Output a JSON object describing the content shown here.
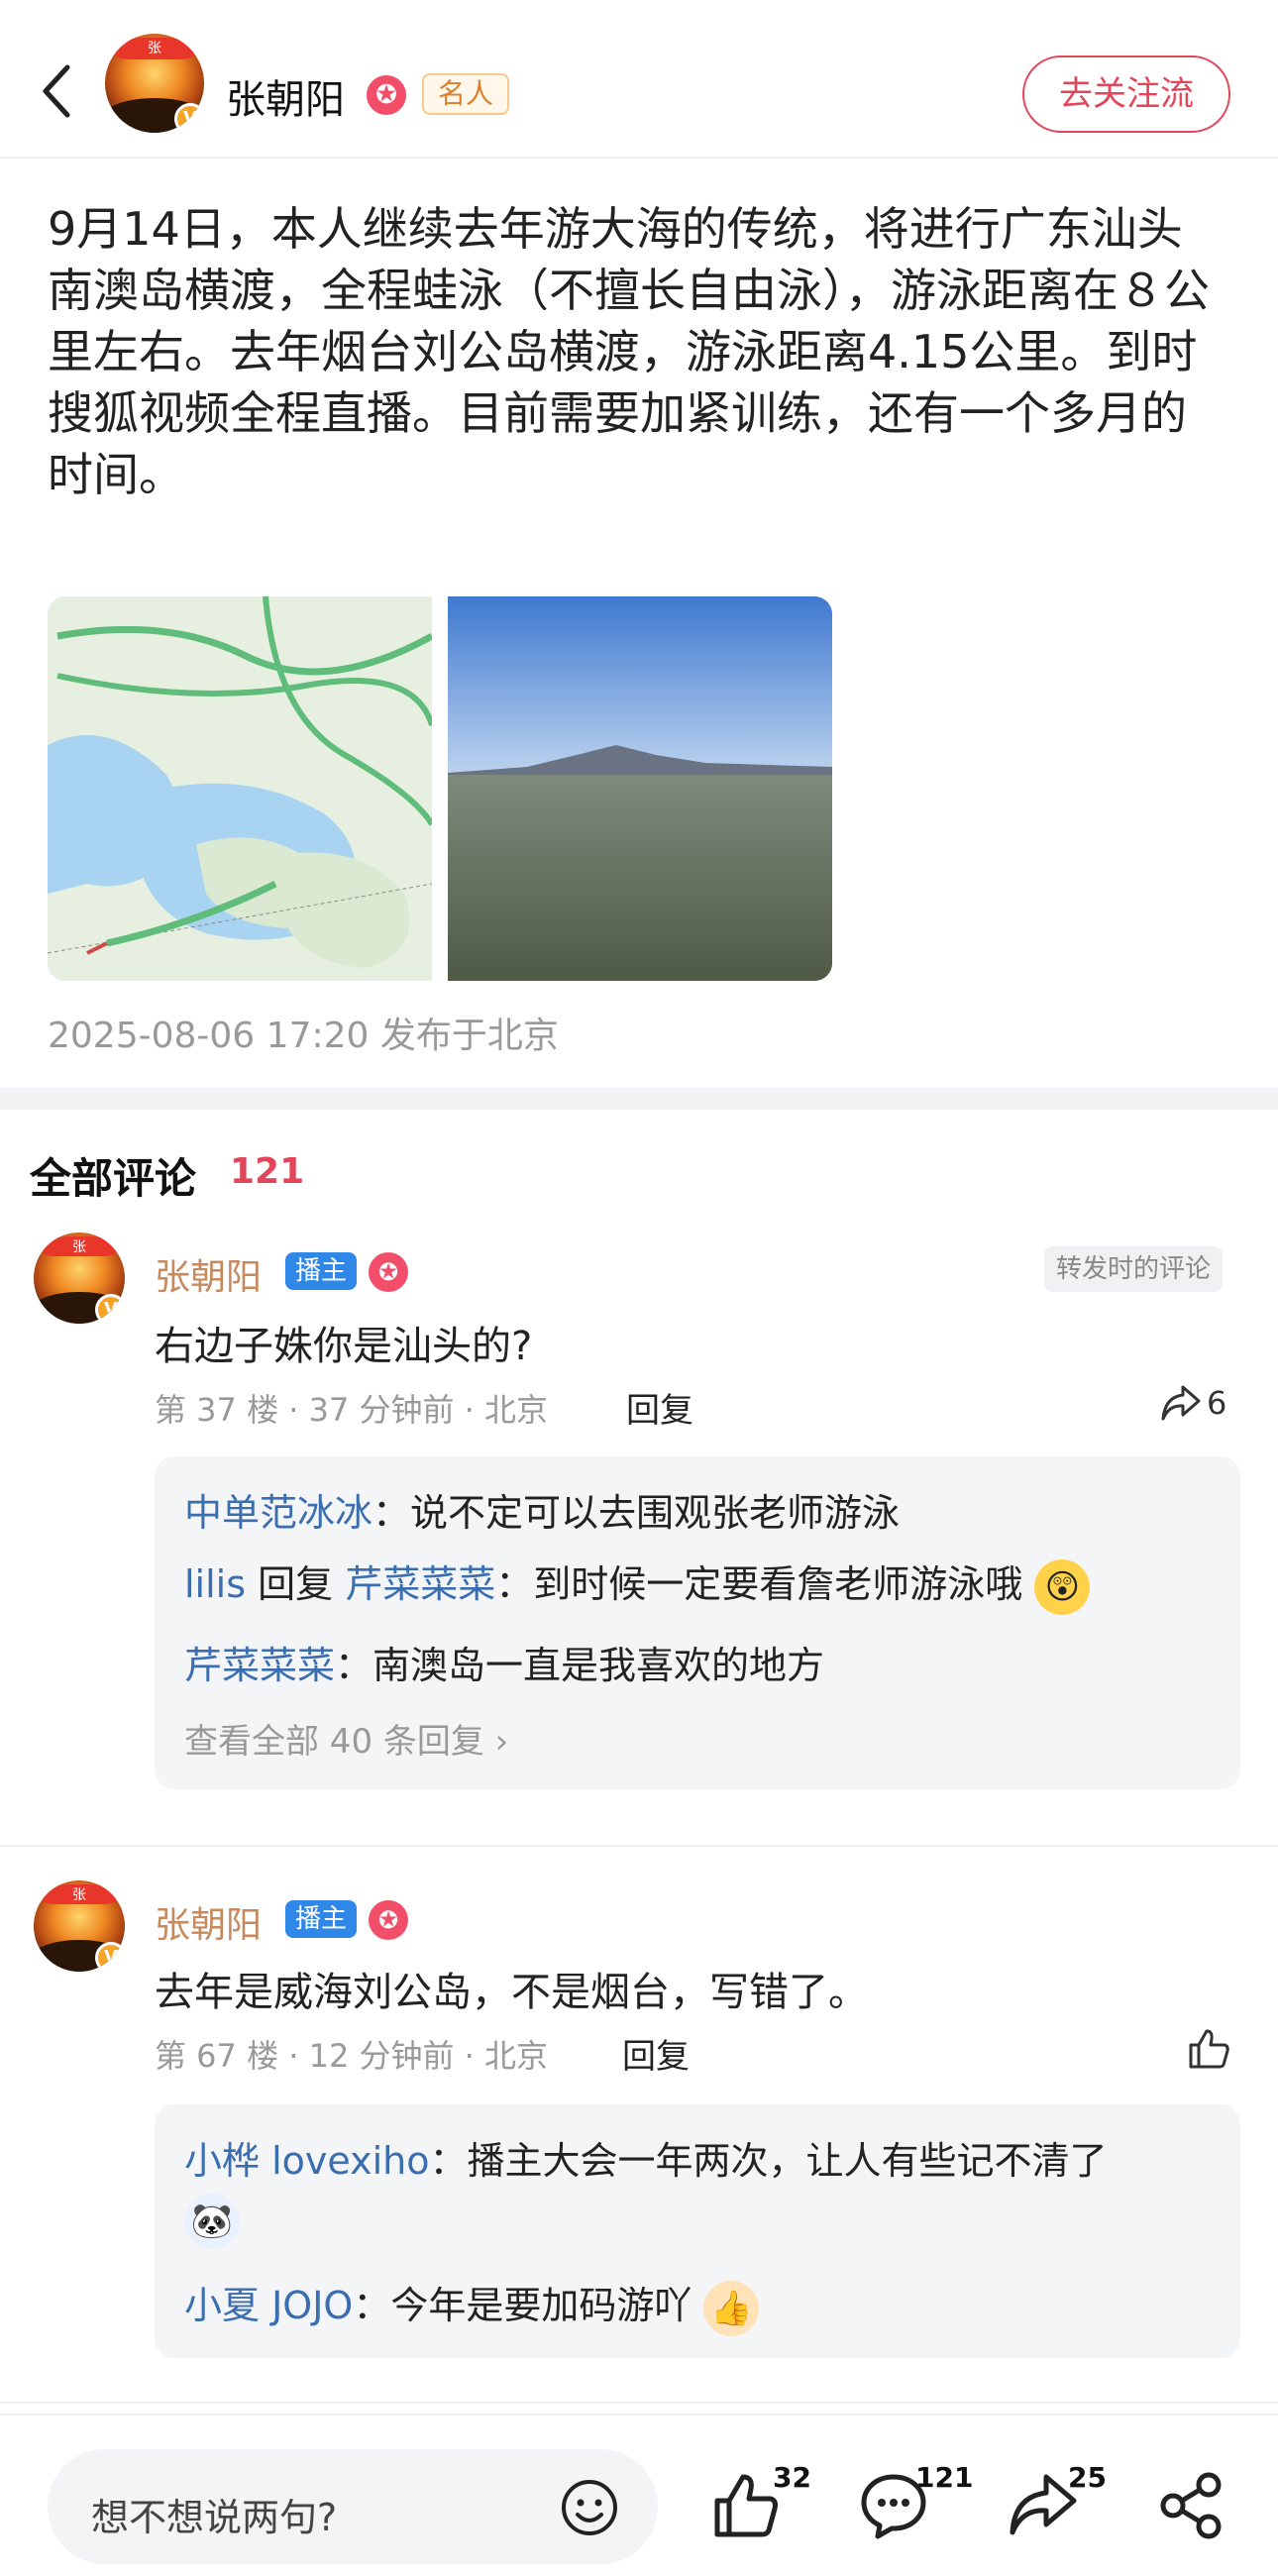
{
  "header": {
    "author_name": "张朝阳",
    "celebrity_tag": "名人",
    "unfollow_label": "去关注流",
    "avatar_crest": "张"
  },
  "post": {
    "text": "9月14日，本人继续去年游大海的传统，将进行广东汕头南澳岛横渡，全程蛙泳（不擅长自由泳），游泳距离在８公里左右。去年烟台刘公岛横渡，游泳距离4.15公里。到时搜狐视频全程直播。目前需要加紧训练，还有一个多月的时间。",
    "meta": "2025-08-06 17:20 发布于北京"
  },
  "comments_section": {
    "title": "全部评论",
    "count": "121"
  },
  "comments": [
    {
      "author": "张朝阳",
      "host_tag": "播主",
      "forward_tag": "转发时的评论",
      "text": "右边子姝你是汕头的?",
      "meta": "第 37 楼 · 37 分钟前 · 北京",
      "reply_label": "回复",
      "share_count": "6",
      "replies": [
        {
          "user": "中单范冰冰",
          "sep": "：",
          "text": "说不定可以去围观张老师游泳"
        },
        {
          "user": "lilis",
          "mid": " 回复 ",
          "target": "芹菜菜菜",
          "sep": "：",
          "text": "到时候一定要看詹老师游泳哦"
        },
        {
          "user": "芹菜菜菜",
          "sep": "：",
          "text": "南澳岛一直是我喜欢的地方"
        }
      ],
      "view_all": "查看全部 40 条回复 ›"
    },
    {
      "author": "张朝阳",
      "host_tag": "播主",
      "text": "去年是威海刘公岛，不是烟台，写错了。",
      "meta": "第 67 楼 · 12 分钟前 · 北京",
      "reply_label": "回复",
      "replies": [
        {
          "user": "小桦 lovexiho",
          "sep": "：",
          "text": "播主大会一年两次，让人有些记不清了"
        },
        {
          "user": "小夏 JOJO",
          "sep": "：",
          "text": "今年是要加码游吖"
        }
      ]
    }
  ],
  "bottom_bar": {
    "input_placeholder": "想不想说两句?",
    "like_count": "32",
    "comment_count": "121",
    "share_count": "25"
  },
  "icons": [
    "back-arrow-icon",
    "star-badge-icon",
    "share-arrow-icon",
    "thumbs-up-icon",
    "smile-icon",
    "comment-bubble-icon",
    "weibo-share-icon"
  ],
  "colors": {
    "accent": "#e2465a",
    "link": "#3a6eb0",
    "host_tag": "#2f87e8",
    "name": "#c78a5e"
  }
}
